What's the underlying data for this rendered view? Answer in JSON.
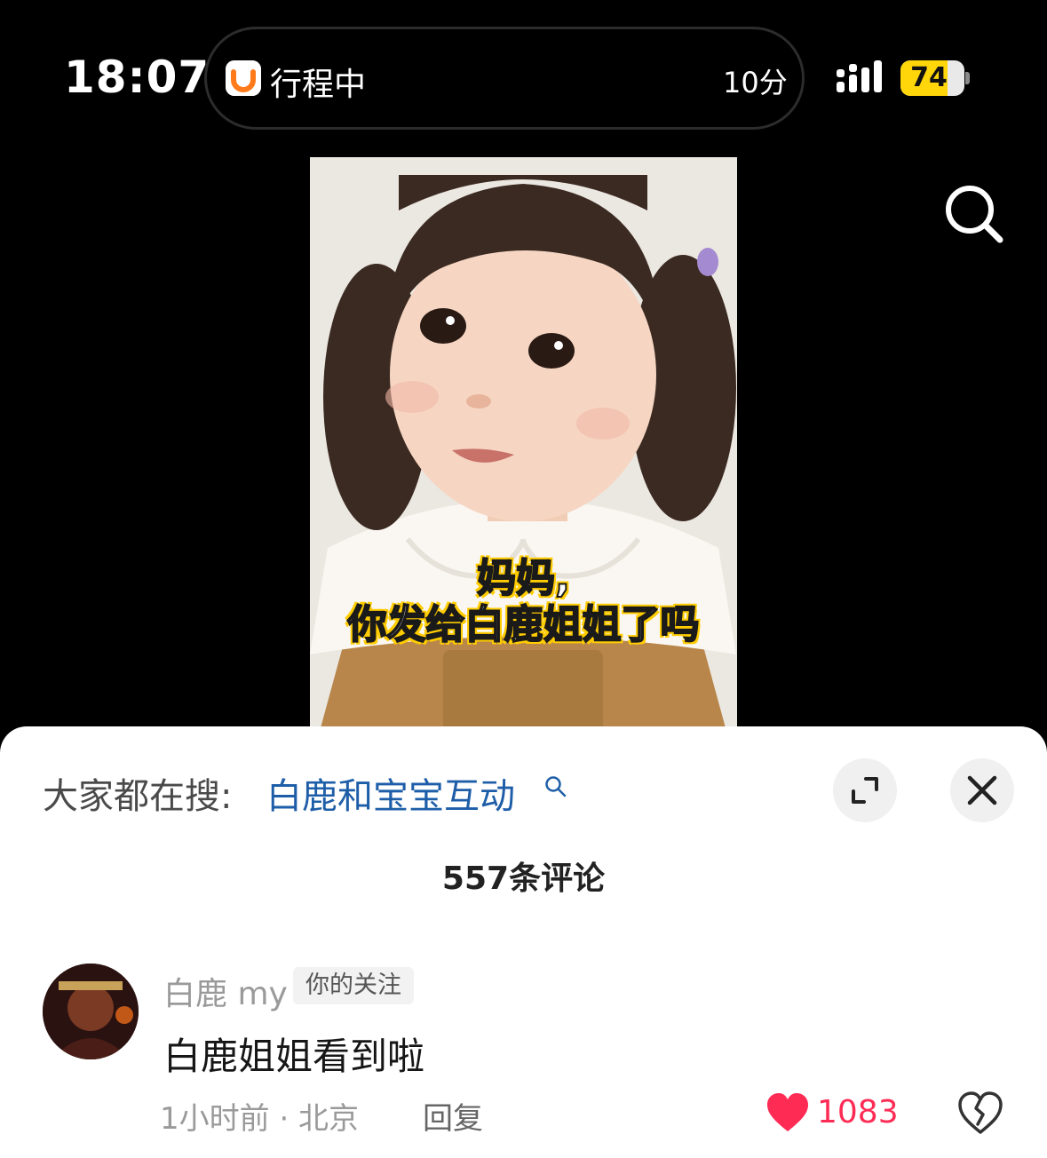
{
  "status_bar": {
    "time": "18:07",
    "live_activity": {
      "app_icon": "didi-icon",
      "label": "行程中",
      "eta": "10分"
    },
    "signal_icon": "signal-icon",
    "battery_level": "74",
    "battery_fraction": 0.74
  },
  "video": {
    "search_icon": "search-icon",
    "caption_line1": "妈妈,",
    "caption_line2": "你发给白鹿姐姐了吗"
  },
  "comment_sheet": {
    "suggest_label": "大家都在搜:",
    "suggest_term": "白鹿和宝宝互动",
    "expand_icon": "expand-icon",
    "close_icon": "close-icon",
    "comment_count": "557条评论",
    "comments": [
      {
        "username": "白鹿 my",
        "tag": "你的关注",
        "text": "白鹿姐姐看到啦",
        "meta": "1小时前 · 北京",
        "reply_label": "回复",
        "likes": "1083",
        "liked": true,
        "like_color": "#fe2c55"
      }
    ]
  }
}
